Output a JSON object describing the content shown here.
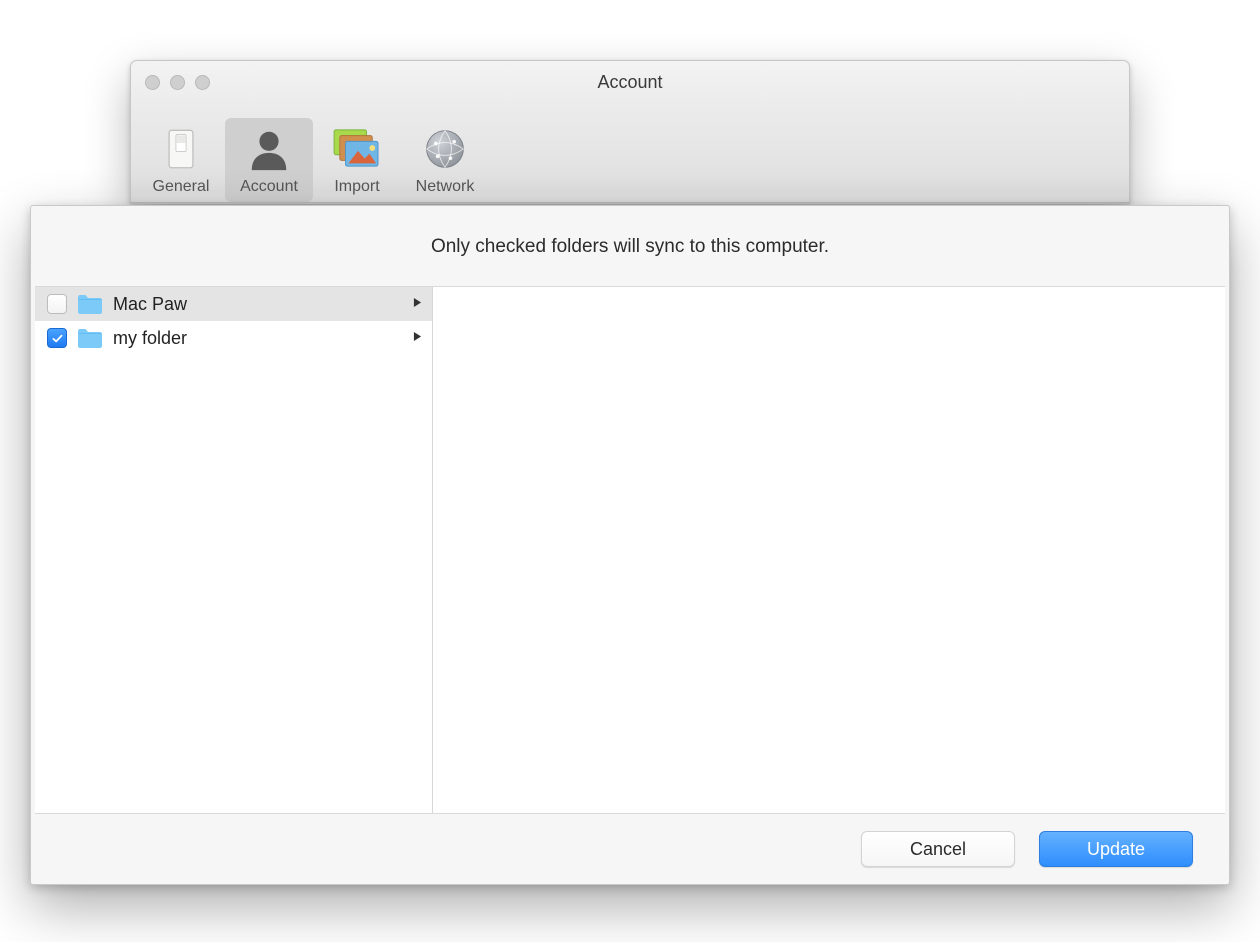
{
  "window": {
    "title": "Account"
  },
  "toolbar": {
    "items": [
      {
        "label": "General"
      },
      {
        "label": "Account"
      },
      {
        "label": "Import"
      },
      {
        "label": "Network"
      }
    ],
    "selected_index": 1
  },
  "sheet": {
    "header_text": "Only checked folders will sync to this computer.",
    "folders": [
      {
        "name": "Mac Paw",
        "checked": false,
        "selected": true
      },
      {
        "name": "my folder",
        "checked": true,
        "selected": false
      }
    ],
    "cancel_label": "Cancel",
    "update_label": "Update"
  }
}
